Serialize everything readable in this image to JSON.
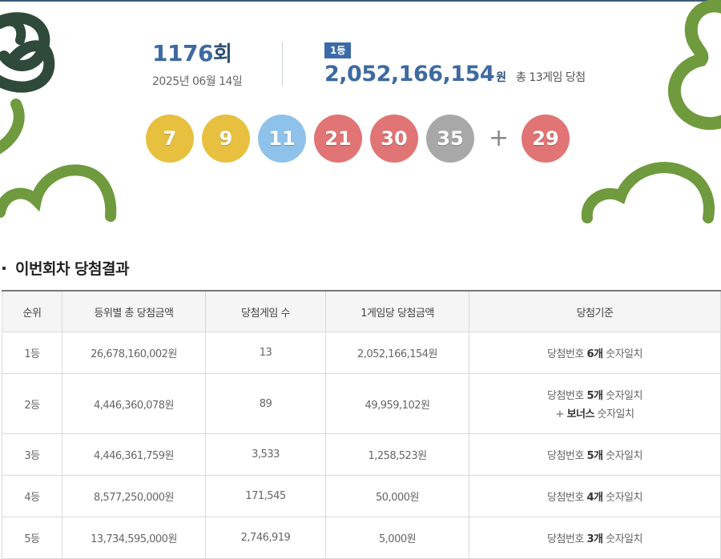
{
  "draw": {
    "round_number": "1176",
    "round_unit": "회",
    "date": "2025년 06월 14일",
    "rank_badge": "1등",
    "first_prize_amount": "2,052,166,154",
    "first_prize_unit": "원",
    "first_prize_note": "총 13게임 당첨",
    "numbers": [
      {
        "value": "7",
        "color": "#e8c040"
      },
      {
        "value": "9",
        "color": "#e8c040"
      },
      {
        "value": "11",
        "color": "#8ec2ea"
      },
      {
        "value": "21",
        "color": "#e17474"
      },
      {
        "value": "30",
        "color": "#e17474"
      },
      {
        "value": "35",
        "color": "#a8a8a8"
      }
    ],
    "plus": "+",
    "bonus": {
      "value": "29",
      "color": "#e17474"
    }
  },
  "colors": {
    "accent_blue": "#3e6aa0",
    "deco_green": "#6f9a3e",
    "deco_dark": "#2f4a3a"
  },
  "section": {
    "title": "이번회차 당첨결과"
  },
  "table": {
    "headers": [
      "순위",
      "등위별 총 당첨금액",
      "당첨게임 수",
      "1게임당 당첨금액",
      "당첨기준"
    ],
    "rows": [
      {
        "rank": "1등",
        "total": "26,678,160,002원",
        "winners": "13",
        "per_game": "2,052,166,154원",
        "criteria_pre": "당첨번호 ",
        "criteria_bold": "6개",
        "criteria_post": " 숫자일치",
        "criteria2_pre": "",
        "criteria2_bold": "",
        "criteria2_post": ""
      },
      {
        "rank": "2등",
        "total": "4,446,360,078원",
        "winners": "89",
        "per_game": "49,959,102원",
        "criteria_pre": "당첨번호 ",
        "criteria_bold": "5개",
        "criteria_post": " 숫자일치",
        "criteria2_pre": "+ ",
        "criteria2_bold": "보너스",
        "criteria2_post": " 숫자일치"
      },
      {
        "rank": "3등",
        "total": "4,446,361,759원",
        "winners": "3,533",
        "per_game": "1,258,523원",
        "criteria_pre": "당첨번호 ",
        "criteria_bold": "5개",
        "criteria_post": " 숫자일치",
        "criteria2_pre": "",
        "criteria2_bold": "",
        "criteria2_post": ""
      },
      {
        "rank": "4등",
        "total": "8,577,250,000원",
        "winners": "171,545",
        "per_game": "50,000원",
        "criteria_pre": "당첨번호 ",
        "criteria_bold": "4개",
        "criteria_post": " 숫자일치",
        "criteria2_pre": "",
        "criteria2_bold": "",
        "criteria2_post": ""
      },
      {
        "rank": "5등",
        "total": "13,734,595,000원",
        "winners": "2,746,919",
        "per_game": "5,000원",
        "criteria_pre": "당첨번호 ",
        "criteria_bold": "3개",
        "criteria_post": " 숫자일치",
        "criteria2_pre": "",
        "criteria2_bold": "",
        "criteria2_post": ""
      }
    ]
  }
}
